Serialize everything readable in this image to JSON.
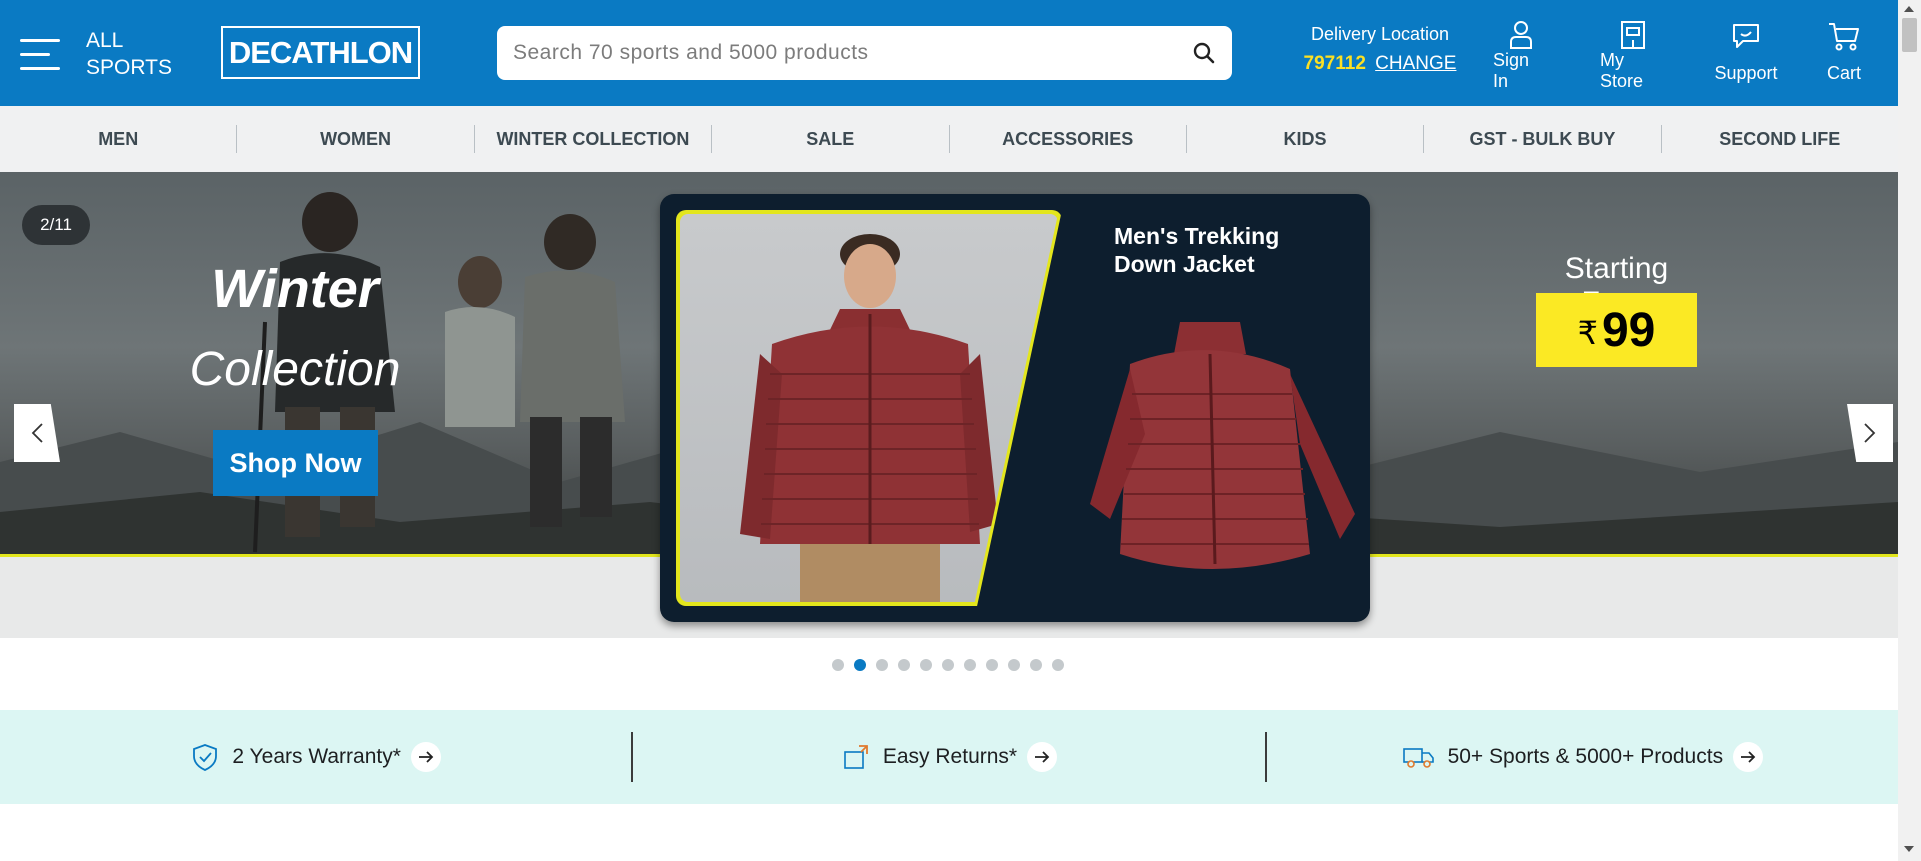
{
  "header": {
    "all_sports_line1": "ALL",
    "all_sports_line2": "SPORTS",
    "logo": "DECATHLON",
    "search_placeholder": "Search 70 sports and 5000 products",
    "delivery_label": "Delivery Location",
    "pincode": "797112",
    "change_label": "CHANGE",
    "actions": [
      {
        "label": "Sign In",
        "icon": "user-icon"
      },
      {
        "label": "My Store",
        "icon": "store-icon"
      },
      {
        "label": "Support",
        "icon": "chat-support-icon"
      },
      {
        "label": "Cart",
        "icon": "cart-icon"
      }
    ],
    "brand_color": "#0a7ac3",
    "pincode_color": "#fbe024"
  },
  "nav": {
    "items": [
      "MEN",
      "WOMEN",
      "WINTER COLLECTION",
      "SALE",
      "ACCESSORIES",
      "KIDS",
      "GST - BULK BUY",
      "SECOND LIFE"
    ]
  },
  "hero": {
    "slide_counter": "2/11",
    "headline": "Winter",
    "subheadline": "Collection",
    "cta": "Shop Now",
    "product_name": "Men's Trekking Down Jacket",
    "starting_label": "Starting From",
    "currency": "₹",
    "price": "99",
    "total_slides": 11,
    "active_slide": 2
  },
  "features": [
    {
      "label": "2 Years Warranty*",
      "icon": "shield-check-icon"
    },
    {
      "label": "Easy Returns*",
      "icon": "returns-box-icon"
    },
    {
      "label": "50+ Sports & 5000+ Products",
      "icon": "delivery-truck-icon"
    }
  ]
}
